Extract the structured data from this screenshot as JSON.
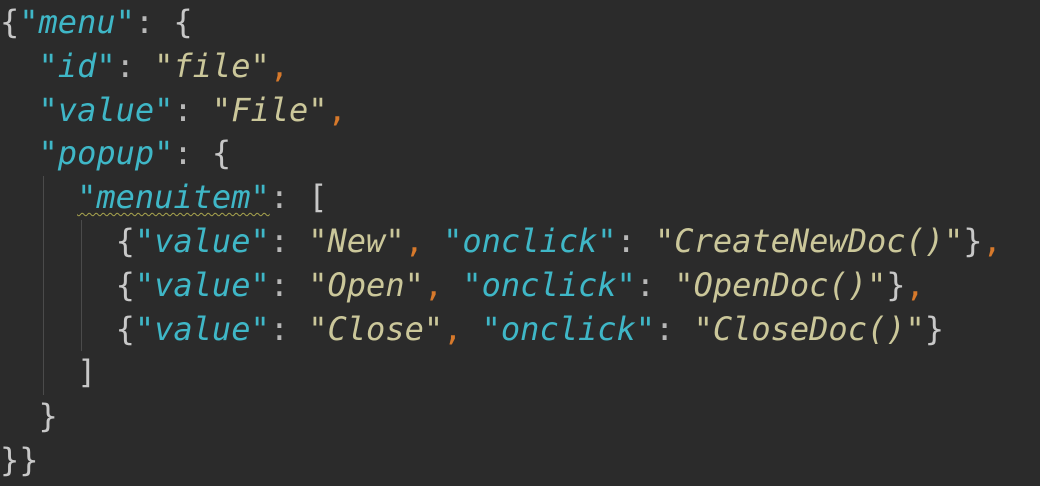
{
  "editor": {
    "lines": [
      {
        "text": "{\"menu\": {"
      },
      {
        "text": "  \"id\": \"file\","
      },
      {
        "text": "  \"value\": \"File\","
      },
      {
        "text": "  \"popup\": {"
      },
      {
        "text": "    \"menuitem\": ["
      },
      {
        "text": "      {\"value\": \"New\", \"onclick\": \"CreateNewDoc()\"},"
      },
      {
        "text": "      {\"value\": \"Open\", \"onclick\": \"OpenDoc()\"},"
      },
      {
        "text": "      {\"value\": \"Close\", \"onclick\": \"CloseDoc()\"}"
      },
      {
        "text": "    ]"
      },
      {
        "text": "  }"
      },
      {
        "text": "}}"
      }
    ],
    "colors": {
      "background": "#2b2b2b",
      "key": "#3fb7c7",
      "string": "#cbc79a",
      "comma": "#d7792b",
      "punctuation": "#b8b8b8"
    }
  }
}
